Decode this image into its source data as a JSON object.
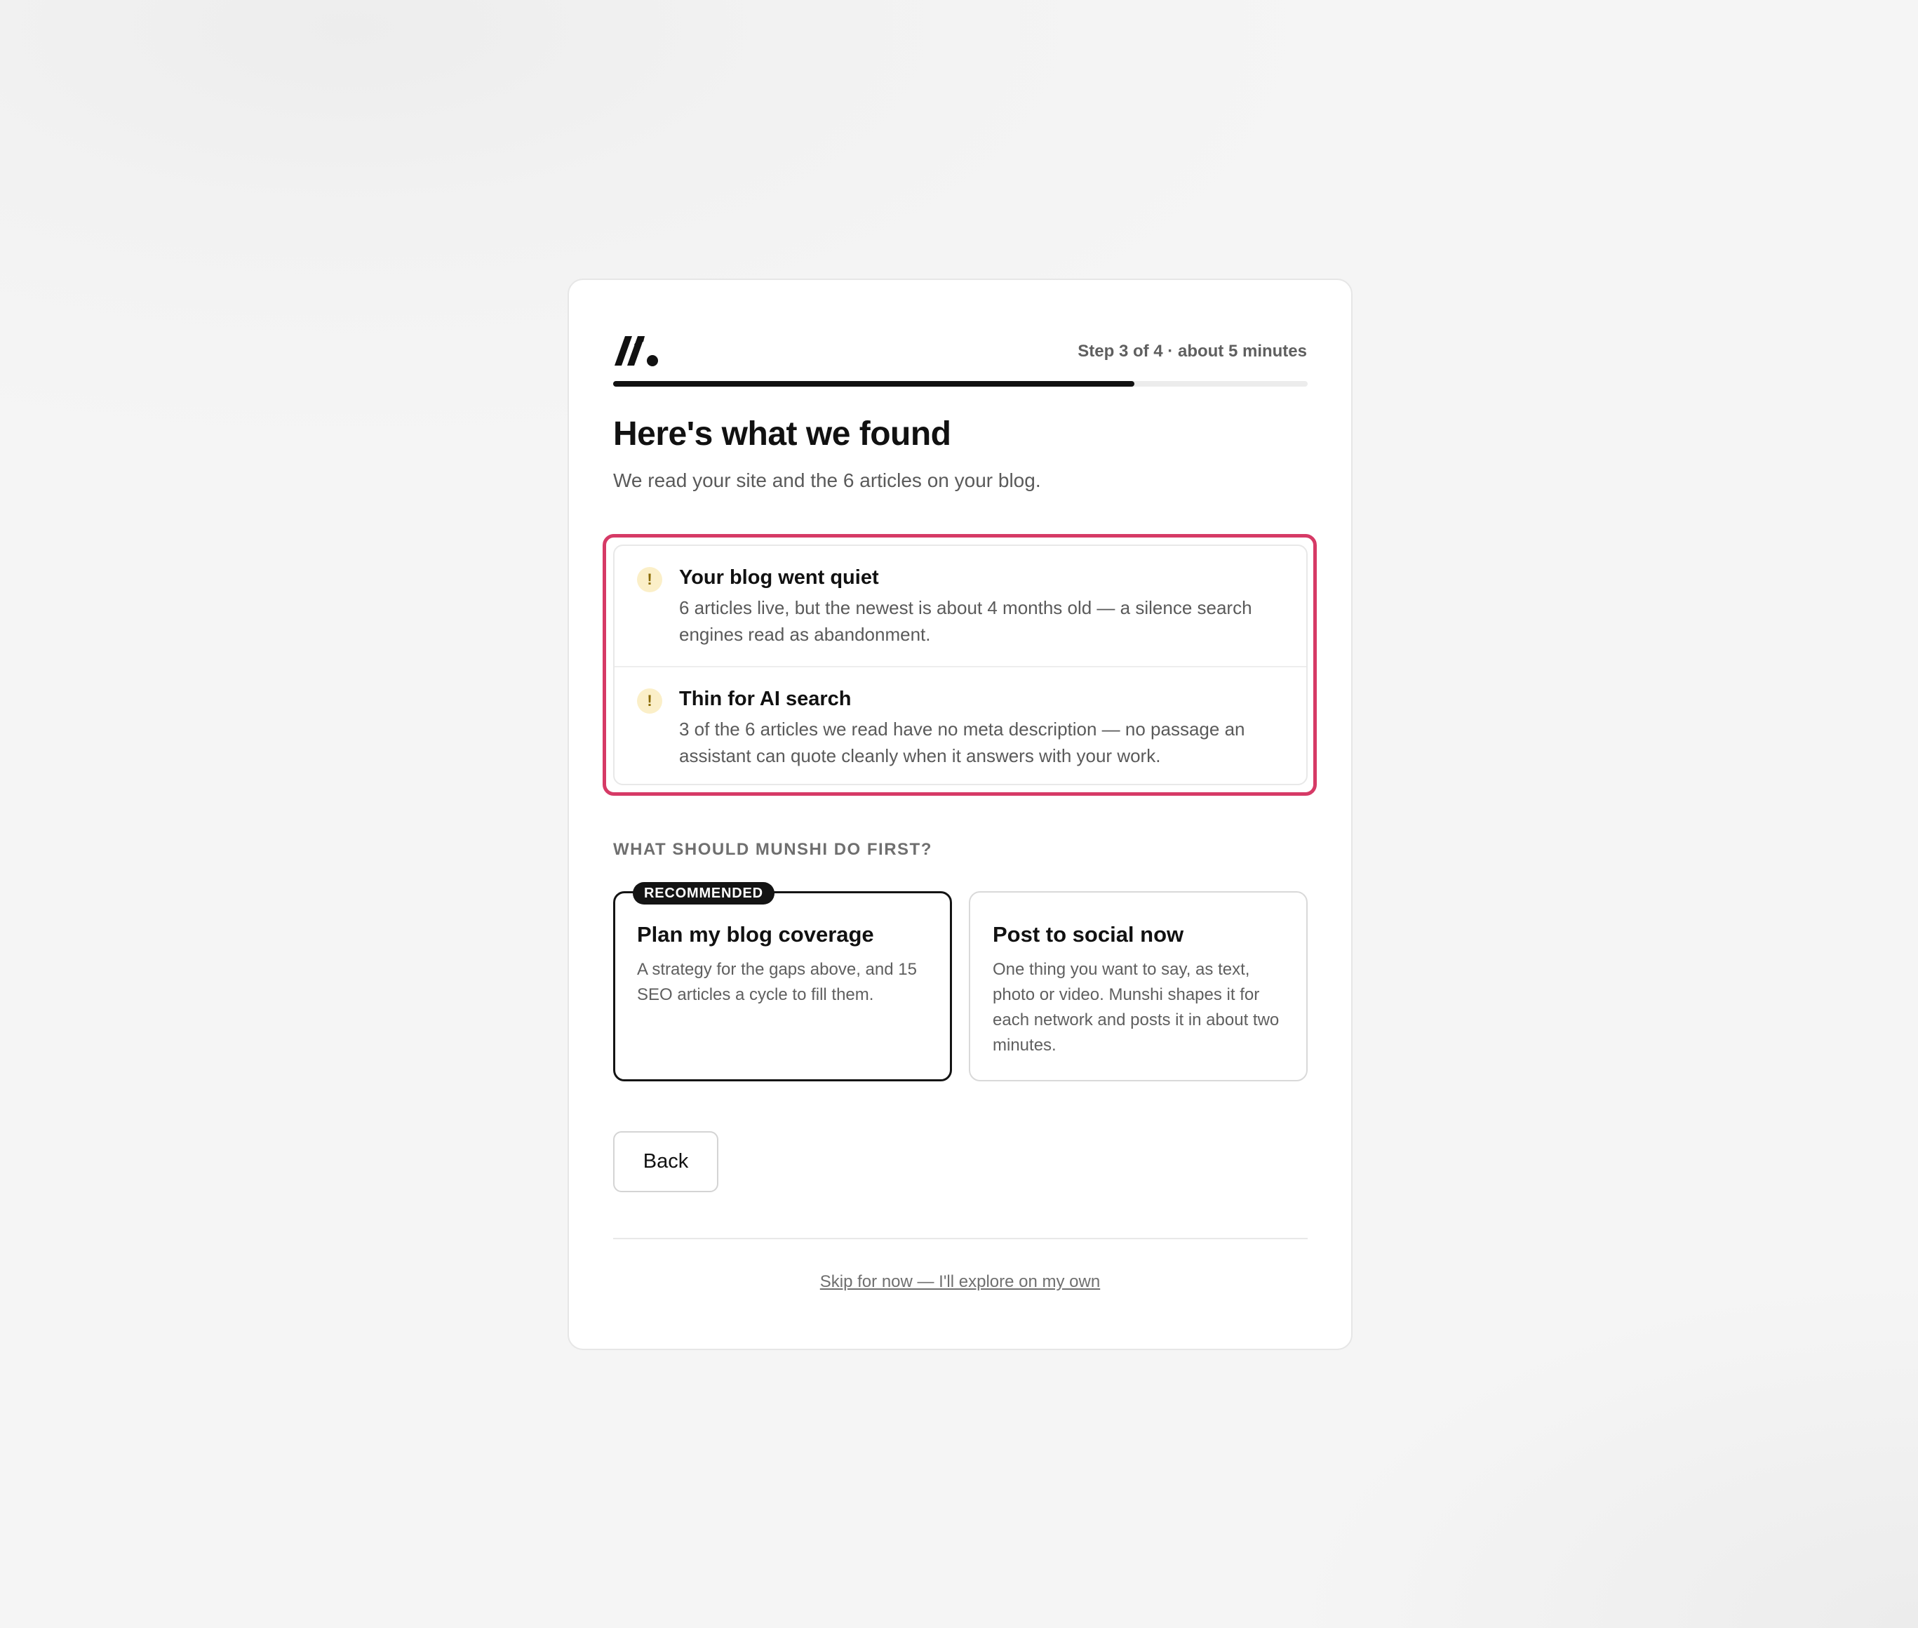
{
  "header": {
    "logo": "munshi-logo",
    "step_label": "Step 3 of 4 · about 5 minutes",
    "progress": 0.75
  },
  "main": {
    "title": "Here's what we found",
    "subtitle": "We read your site and the 6 articles on your blog."
  },
  "findings": [
    {
      "icon": "warning-icon",
      "title": "Your blog went quiet",
      "body": "6 articles live, but the newest is about 4 months old — a silence search engines read as abandonment."
    },
    {
      "icon": "warning-icon",
      "title": "Thin for AI search",
      "body": "3 of the 6 articles we read have no meta description — no passage an assistant can quote cleanly when it answers with your work."
    }
  ],
  "section_label": "WHAT SHOULD MUNSHI DO FIRST?",
  "options": [
    {
      "badge": "RECOMMENDED",
      "title": "Plan my blog coverage",
      "body": "A strategy for the gaps above, and 15 SEO articles a cycle to fill them.",
      "selected": true
    },
    {
      "title": "Post to social now",
      "body": "One thing you want to say, as text, photo or video. Munshi shapes it for each network and posts it in about two minutes.",
      "selected": false
    }
  ],
  "actions": {
    "back_label": "Back",
    "skip_label": "Skip for now — I'll explore on my own"
  },
  "colors": {
    "highlight": "#d63a66",
    "warning_bg": "#fbefc8",
    "primary": "#141414"
  }
}
